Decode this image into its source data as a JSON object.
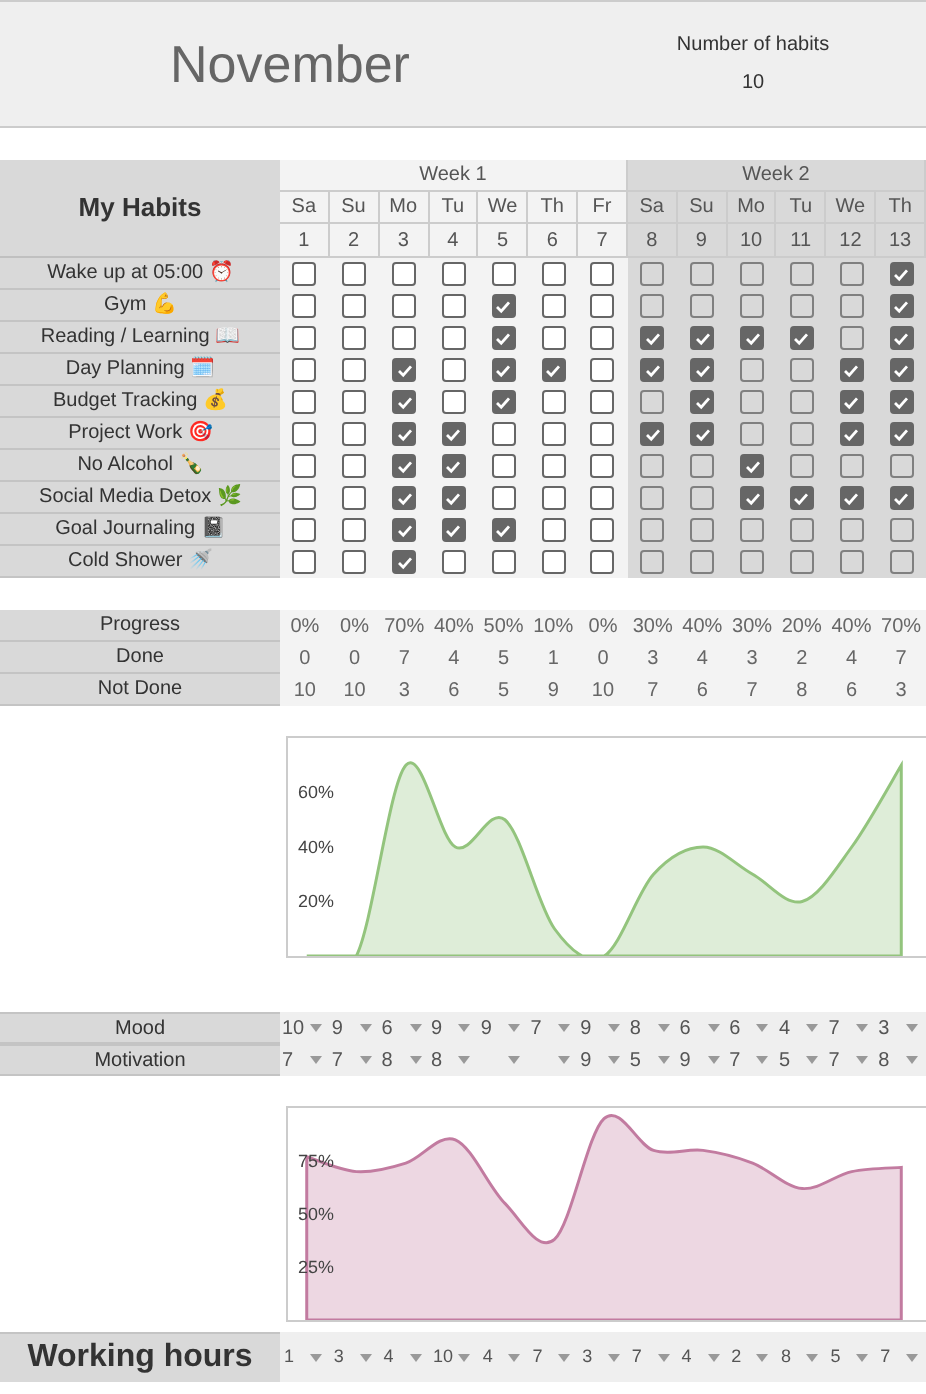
{
  "header": {
    "month": "November",
    "habit_count_label": "Number of habits",
    "habit_count": "10"
  },
  "habits_table": {
    "title": "My Habits",
    "weeks": [
      {
        "label": "Week 1",
        "days": [
          {
            "name": "Sa",
            "date": "1"
          },
          {
            "name": "Su",
            "date": "2"
          },
          {
            "name": "Mo",
            "date": "3"
          },
          {
            "name": "Tu",
            "date": "4"
          },
          {
            "name": "We",
            "date": "5"
          },
          {
            "name": "Th",
            "date": "6"
          },
          {
            "name": "Fr",
            "date": "7"
          }
        ]
      },
      {
        "label": "Week 2",
        "days": [
          {
            "name": "Sa",
            "date": "8"
          },
          {
            "name": "Su",
            "date": "9"
          },
          {
            "name": "Mo",
            "date": "10"
          },
          {
            "name": "Tu",
            "date": "11"
          },
          {
            "name": "We",
            "date": "12"
          },
          {
            "name": "Th",
            "date": "13"
          }
        ]
      }
    ],
    "habits": [
      {
        "name": "Wake up at 05:00 ⏰",
        "checks": [
          false,
          false,
          false,
          false,
          false,
          false,
          false,
          false,
          false,
          false,
          false,
          false,
          true
        ]
      },
      {
        "name": "Gym 💪",
        "checks": [
          false,
          false,
          false,
          false,
          true,
          false,
          false,
          false,
          false,
          false,
          false,
          false,
          true
        ]
      },
      {
        "name": "Reading / Learning 📖",
        "checks": [
          false,
          false,
          false,
          false,
          true,
          false,
          false,
          true,
          true,
          true,
          true,
          false,
          true
        ]
      },
      {
        "name": "Day Planning 🗓️",
        "checks": [
          false,
          false,
          true,
          false,
          true,
          true,
          false,
          true,
          true,
          false,
          false,
          true,
          true
        ]
      },
      {
        "name": "Budget Tracking 💰",
        "checks": [
          false,
          false,
          true,
          false,
          true,
          false,
          false,
          false,
          true,
          false,
          false,
          true,
          true
        ]
      },
      {
        "name": "Project Work 🎯",
        "checks": [
          false,
          false,
          true,
          true,
          false,
          false,
          false,
          true,
          true,
          false,
          false,
          true,
          true
        ]
      },
      {
        "name": "No Alcohol 🍾",
        "checks": [
          false,
          false,
          true,
          true,
          false,
          false,
          false,
          false,
          false,
          true,
          false,
          false,
          false
        ]
      },
      {
        "name": "Social Media Detox 🌿",
        "checks": [
          false,
          false,
          true,
          true,
          false,
          false,
          false,
          false,
          false,
          true,
          true,
          true,
          true
        ]
      },
      {
        "name": "Goal Journaling 📓",
        "checks": [
          false,
          false,
          true,
          true,
          true,
          false,
          false,
          false,
          false,
          false,
          false,
          false,
          false
        ]
      },
      {
        "name": "Cold Shower 🚿",
        "checks": [
          false,
          false,
          true,
          false,
          false,
          false,
          false,
          false,
          false,
          false,
          false,
          false,
          false
        ]
      }
    ]
  },
  "stats": [
    {
      "label": "Progress",
      "values": [
        "0%",
        "0%",
        "70%",
        "40%",
        "50%",
        "10%",
        "0%",
        "30%",
        "40%",
        "30%",
        "20%",
        "40%",
        "70%"
      ]
    },
    {
      "label": "Done",
      "values": [
        "0",
        "0",
        "7",
        "4",
        "5",
        "1",
        "0",
        "3",
        "4",
        "3",
        "2",
        "4",
        "7"
      ]
    },
    {
      "label": "Not Done",
      "values": [
        "10",
        "10",
        "3",
        "6",
        "5",
        "9",
        "10",
        "7",
        "6",
        "7",
        "8",
        "6",
        "3"
      ]
    }
  ],
  "progress_chart": {
    "chart_data": {
      "type": "area",
      "ylim": [
        0,
        80
      ],
      "yticks": [
        {
          "value": 20,
          "label": "20%"
        },
        {
          "value": 40,
          "label": "40%"
        },
        {
          "value": 60,
          "label": "60%"
        }
      ],
      "series": [
        {
          "color": "#93c47d",
          "values": [
            0,
            0,
            70,
            40,
            50,
            10,
            0,
            30,
            40,
            30,
            20,
            40,
            70
          ]
        }
      ]
    }
  },
  "ratings": [
    {
      "label": "Mood",
      "values": [
        "10",
        "9",
        "6",
        "9",
        "9",
        "7",
        "9",
        "8",
        "6",
        "6",
        "4",
        "7",
        "3"
      ]
    },
    {
      "label": "Motivation",
      "values": [
        "7",
        "7",
        "8",
        "8",
        {
          "kind": "blank"
        },
        {
          "kind": "blank"
        },
        "9",
        "5",
        "9",
        "7",
        "5",
        "7",
        "8"
      ]
    }
  ],
  "mood_chart": {
    "chart_data": {
      "type": "area",
      "ylim": [
        0,
        100
      ],
      "yticks": [
        {
          "value": 25,
          "label": "25%"
        },
        {
          "value": 50,
          "label": "50%"
        },
        {
          "value": 75,
          "label": "75%"
        }
      ],
      "series": [
        {
          "color": "#c27ba0",
          "values": [
            77,
            70,
            74,
            85,
            55,
            38,
            95,
            80,
            80,
            74,
            62,
            70,
            72
          ]
        }
      ]
    }
  },
  "working_hours": {
    "label": "Working hours",
    "values": [
      "1",
      "3",
      "4",
      "10",
      "4",
      "7",
      "3",
      "7",
      "4",
      "2",
      "8",
      "5",
      "7"
    ]
  }
}
